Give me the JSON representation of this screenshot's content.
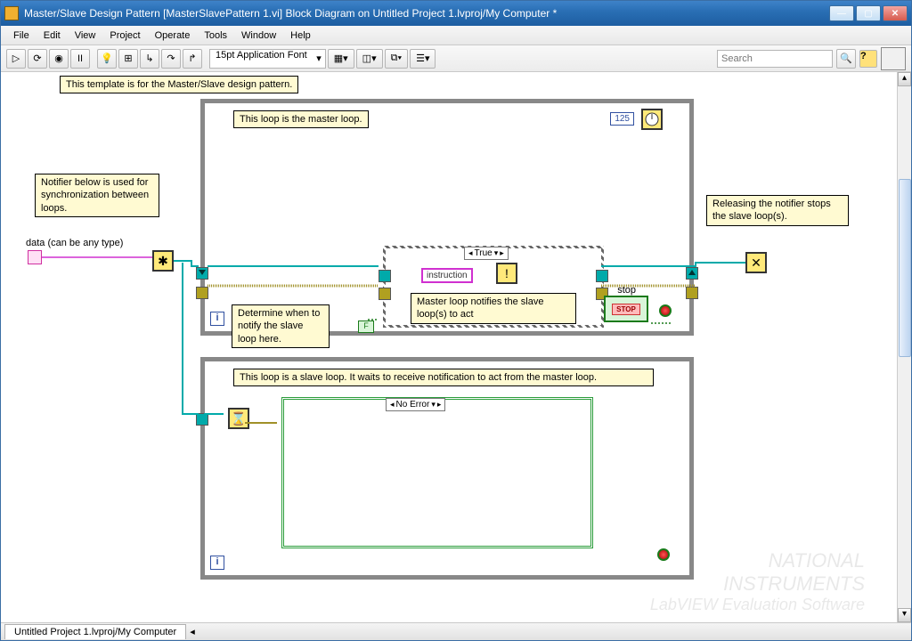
{
  "window": {
    "title": "Master/Slave Design Pattern [MasterSlavePattern 1.vi] Block Diagram on Untitled Project 1.lvproj/My Computer *"
  },
  "menu": [
    "File",
    "Edit",
    "View",
    "Project",
    "Operate",
    "Tools",
    "Window",
    "Help"
  ],
  "toolbar": {
    "font": "15pt Application Font",
    "search_placeholder": "Search"
  },
  "comments": {
    "template": "This template is for the Master/Slave design pattern.",
    "master_loop": "This loop is the master loop.",
    "notifier_info": "Notifier below is used for synchronization between loops.",
    "determine": "Determine when to notify the slave loop here.",
    "master_notify": "Master loop notifies the slave loop(s) to act",
    "release": "Releasing the notifier stops the slave loop(s).",
    "slave_loop": "This loop is a slave loop. It waits to receive notification to act from the master loop."
  },
  "labels": {
    "data_type": "data (can be any type)",
    "instruction": "instruction",
    "stop": "stop",
    "stop_inner": "STOP",
    "loop_i": "i",
    "bool_false": "F"
  },
  "constants": {
    "wait_ms": "125"
  },
  "case_selectors": {
    "true_case": "True",
    "no_error": "No Error"
  },
  "status": {
    "path": "Untitled Project 1.lvproj/My Computer"
  },
  "watermark": {
    "line1": "NATIONAL",
    "line2": "INSTRUMENTS",
    "line3": "LabVIEW Evaluation Software"
  }
}
